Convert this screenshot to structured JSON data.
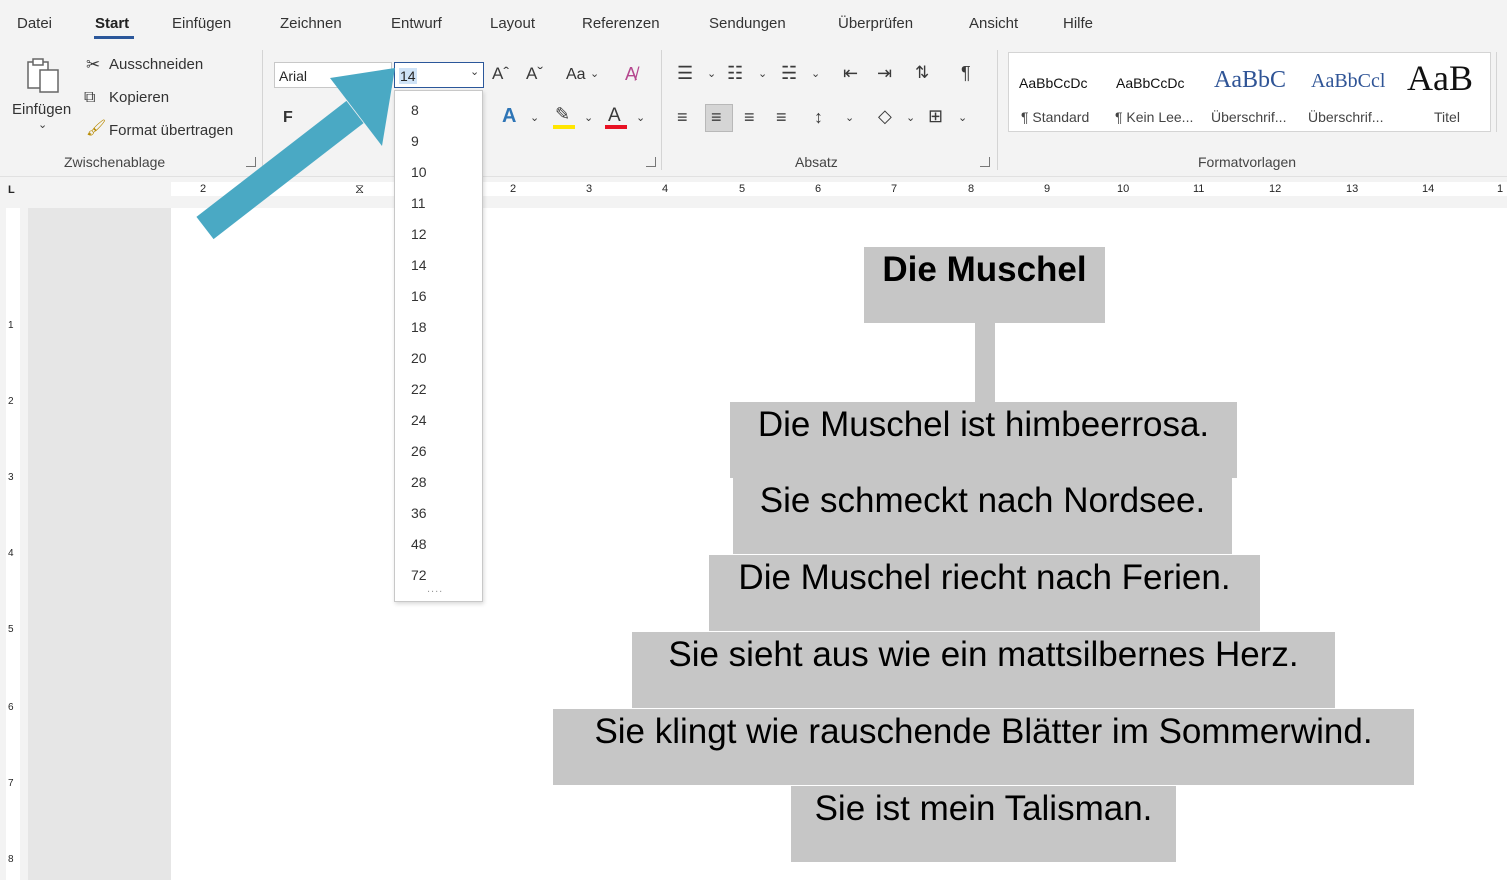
{
  "menu": {
    "tabs": [
      "Datei",
      "Start",
      "Einfügen",
      "Zeichnen",
      "Entwurf",
      "Layout",
      "Referenzen",
      "Sendungen",
      "Überprüfen",
      "Ansicht",
      "Hilfe"
    ],
    "active": "Start"
  },
  "clipboard": {
    "paste_label": "Einfügen",
    "cut_label": "Ausschneiden",
    "copy_label": "Kopieren",
    "format_painter_label": "Format übertragen",
    "group_label": "Zwischenablage"
  },
  "font": {
    "family_value": "Arial",
    "size_value": "14",
    "bold_label": "F",
    "case_label": "Aa"
  },
  "paragraph": {
    "group_label": "Absatz"
  },
  "styles": {
    "group_label": "Formatvorlagen",
    "items": [
      {
        "preview": "AaBbCcDc",
        "name": "¶ Standard"
      },
      {
        "preview": "AaBbCcDc",
        "name": "¶ Kein Lee..."
      },
      {
        "preview": "AaBbC",
        "name": "Überschrif..."
      },
      {
        "preview": "AaBbCcl",
        "name": "Überschrif..."
      },
      {
        "preview": "AaB",
        "name": "Titel"
      }
    ]
  },
  "size_dropdown": {
    "options": [
      "8",
      "9",
      "10",
      "11",
      "12",
      "14",
      "16",
      "18",
      "20",
      "22",
      "24",
      "26",
      "28",
      "36",
      "48",
      "72"
    ],
    "more": "...."
  },
  "ruler": {
    "left_label": "L",
    "marks": [
      "2",
      "1",
      "2",
      "3",
      "4",
      "5",
      "6",
      "7",
      "8",
      "9",
      "10",
      "11",
      "12",
      "13",
      "14",
      "1"
    ],
    "vmarks": [
      "1",
      "2",
      "3",
      "4",
      "5",
      "6",
      "7",
      "8"
    ]
  },
  "document": {
    "title": "Die Muschel",
    "lines": [
      "Die Muschel ist himbeerrosa.",
      "Sie schmeckt nach Nordsee.",
      "Die Muschel riecht nach Ferien.",
      "Sie sieht aus wie ein mattsilbernes Herz.",
      "Sie klingt wie rauschende Blätter im Sommerwind.",
      "Sie ist mein Talisman."
    ]
  },
  "colors": {
    "accent": "#2b579a",
    "arrow": "#4aa9c4",
    "highlight": "#c6c6c6",
    "font_color": "#e81123",
    "highlight_pen": "#ffe600"
  }
}
